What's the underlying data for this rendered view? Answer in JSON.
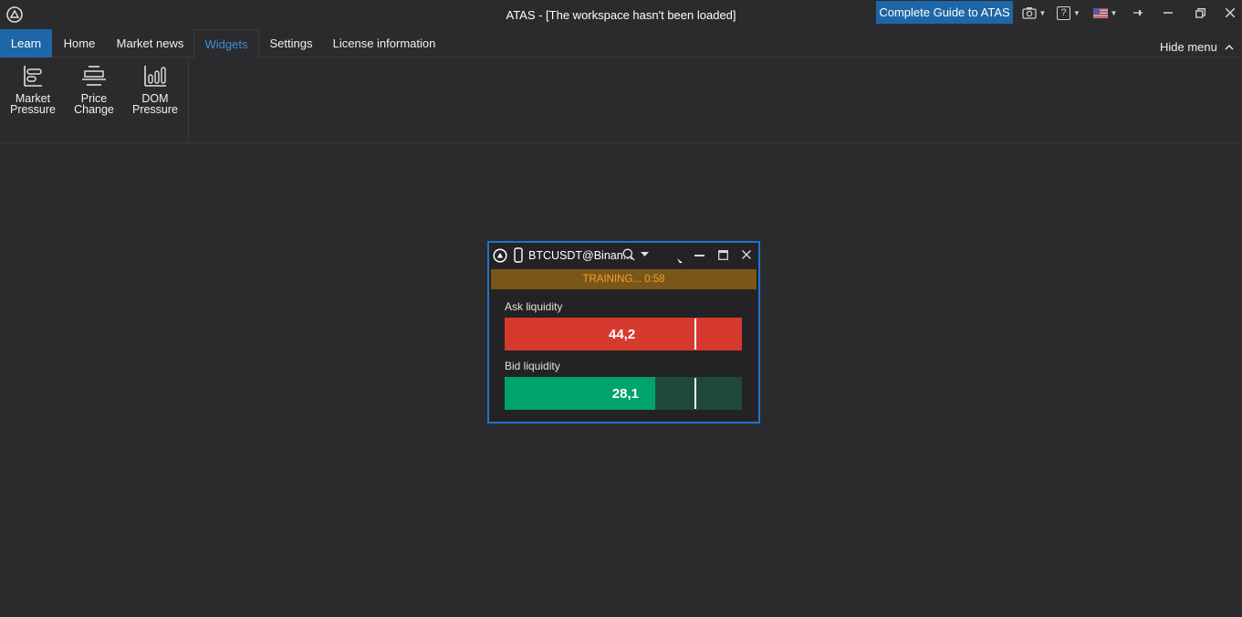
{
  "window": {
    "title": "ATAS - [The workspace hasn't been loaded]",
    "guide_button": "Complete Guide to ATAS",
    "icons": [
      "atas-logo-icon",
      "camera-icon",
      "help-icon",
      "us-flag-icon",
      "pin-icon",
      "minimize-icon",
      "restore-icon",
      "close-icon"
    ],
    "help_label": "?"
  },
  "menu": {
    "tabs": [
      {
        "label": "Learn"
      },
      {
        "label": "Home"
      },
      {
        "label": "Market news"
      },
      {
        "label": "Widgets"
      },
      {
        "label": "Settings"
      },
      {
        "label": "License information"
      }
    ],
    "active_tab": "Widgets",
    "hide_menu": "Hide menu"
  },
  "ribbon": {
    "items": [
      {
        "label": "Market\nPressure",
        "icon": "market-pressure-icon"
      },
      {
        "label": "Price\nChange",
        "icon": "price-change-icon"
      },
      {
        "label": "DOM\nPressure",
        "icon": "dom-pressure-icon"
      }
    ]
  },
  "widget": {
    "title": "BTCUSDT@Binan...",
    "training": "TRAINING... 0:58",
    "ask": {
      "label": "Ask liquidity",
      "value": "44,2",
      "fill_fraction": 1.0,
      "marker_fraction": 0.8,
      "color": "#d63a2f",
      "bg": "#d63a2f"
    },
    "bid": {
      "label": "Bid liquidity",
      "value": "28,1",
      "fill_fraction": 0.635,
      "marker_fraction": 0.8,
      "color": "#00a36c",
      "bg": "#1f4a3b"
    }
  },
  "colors": {
    "accent": "#1e66a8",
    "active_tab": "#3d8fd9",
    "training_bg": "#7a5618",
    "training_text": "#f1a02a"
  }
}
